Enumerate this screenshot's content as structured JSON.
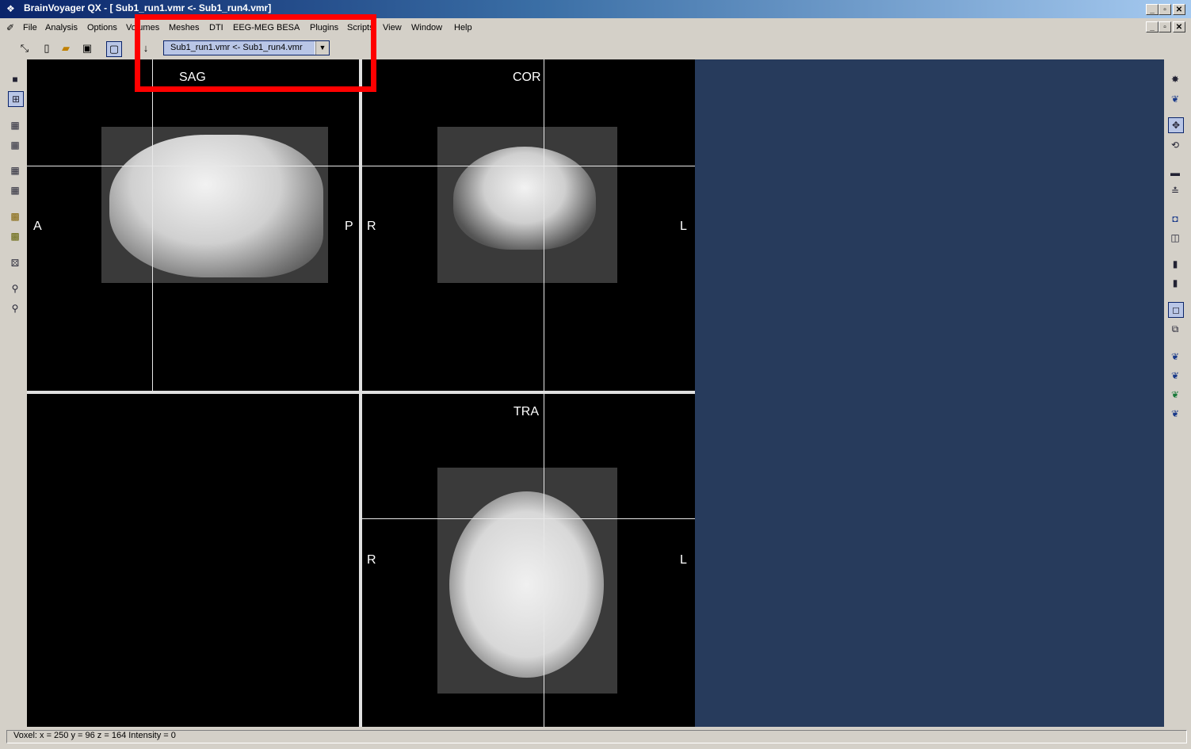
{
  "window": {
    "title": "BrainVoyager QX - [ Sub1_run1.vmr  <-  Sub1_run4.vmr]",
    "sys_buttons": [
      "_",
      "▫",
      "✕"
    ]
  },
  "menu": {
    "items": [
      "File",
      "Analysis",
      "Options",
      "Volumes",
      "Meshes",
      "DTI",
      "EEG-MEG BESA",
      "Plugins",
      "Scripts",
      "View",
      "Window",
      "Help"
    ]
  },
  "toolbar": {
    "document_select": "Sub1_run1.vmr  <-  Sub1_run4.vmr"
  },
  "views": {
    "sag": {
      "title": "SAG",
      "left": "A",
      "right": "P"
    },
    "cor": {
      "title": "COR",
      "left": "R",
      "right": "L"
    },
    "tra": {
      "title": "TRA",
      "left": "R",
      "right": "L"
    }
  },
  "status": {
    "text": "Voxel:  x = 250 y = 96 z = 164  Intensity = 0"
  },
  "colors": {
    "titlebar": "#0a246a",
    "workspace_blue": "#273b5c",
    "highlight_box": "#ff0000"
  }
}
